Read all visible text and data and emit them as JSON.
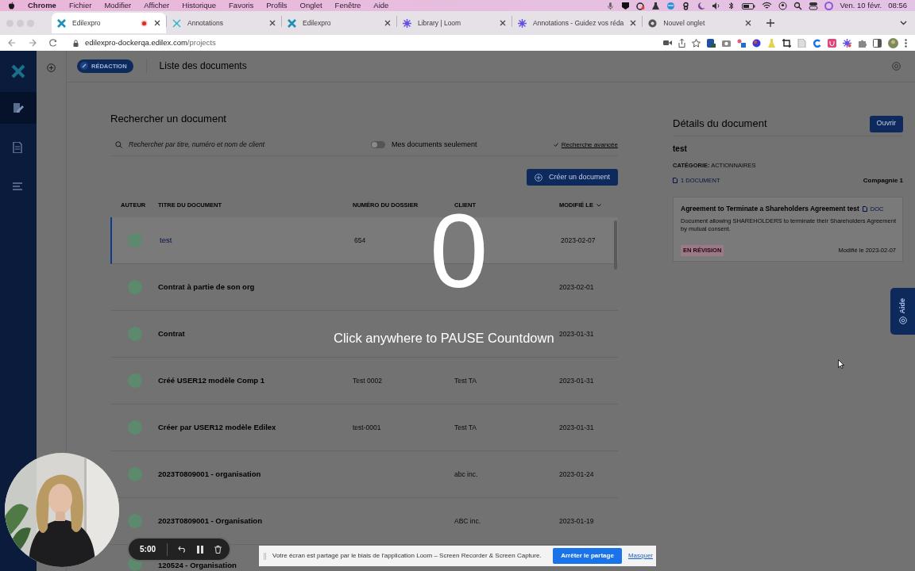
{
  "menubar": {
    "app_name": "Chrome",
    "menus": [
      "Fichier",
      "Modifier",
      "Afficher",
      "Historique",
      "Favoris",
      "Profils",
      "Onglet",
      "Fenêtre",
      "Aide"
    ],
    "date": "Ven. 10 févr.",
    "time": "08:56"
  },
  "tabs": [
    {
      "title": "Edilexpro",
      "kind": "edilex",
      "selected": true,
      "recording": true
    },
    {
      "title": "Annotations",
      "kind": "annotations",
      "selected": false,
      "recording": false
    },
    {
      "title": "Edilexpro",
      "kind": "edilex",
      "selected": false,
      "recording": false
    },
    {
      "title": "Library | Loom",
      "kind": "loom",
      "selected": false,
      "recording": false
    },
    {
      "title": "Annotations - Guidez vos réda",
      "kind": "loom",
      "selected": false,
      "recording": false
    },
    {
      "title": "Nouvel onglet",
      "kind": "chrome",
      "selected": false,
      "recording": false
    }
  ],
  "address": {
    "host": "edilexpro-dockerqa.edilex.com",
    "path": "/projects"
  },
  "app": {
    "mode_badge": "RÉDACTION",
    "page_title": "Liste des documents",
    "nav": [
      {
        "kind": "edit",
        "selected": true
      },
      {
        "kind": "document",
        "selected": false
      },
      {
        "kind": "list",
        "selected": false
      }
    ]
  },
  "search": {
    "heading": "Rechercher un document",
    "placeholder": "Rechercher par titre, numéro et nom de client",
    "toggle": {
      "label": "Mes documents seulement",
      "on": false
    },
    "advanced_link": "Recherche avancée",
    "create_button": "Créer un document"
  },
  "table": {
    "columns": [
      "AUTEUR",
      "TITRE DU DOCUMENT",
      "NUMÉRO DU DOSSIER",
      "CLIENT",
      "MODIFIÉ LE"
    ],
    "rows": [
      {
        "title": "test",
        "file_no": "654",
        "date": "2023-02-07",
        "selected": true
      },
      {
        "title": "Contrat à partie de son org",
        "date": "2023-02-01",
        "selected": false
      },
      {
        "title": "Contrat",
        "date": "2023-01-31",
        "selected": false
      },
      {
        "title": "Créé USER12 modèle Comp 1",
        "file_no": "Test 0002",
        "client": "Test TA",
        "date": "2023-01-31",
        "selected": false
      },
      {
        "title": "Créer par USER12 modèle Edilex",
        "file_no": "test-0001",
        "client": "Test TA",
        "date": "2023-01-31",
        "selected": false
      },
      {
        "title": "2023T0809001 - organisation",
        "client": "abc inc.",
        "date": "2023-01-24",
        "selected": false
      },
      {
        "title": "2023T0809001 - Organisation",
        "client": "ABC inc.",
        "date": "2023-01-19",
        "selected": false
      },
      {
        "title": "120524 - Organisation",
        "selected": false
      }
    ]
  },
  "details": {
    "heading": "Détails du document",
    "open_button": "Ouvrir",
    "name": "test",
    "category_label": "CATÉGORIE:",
    "category": "ACTIONNAIRES",
    "doc_count": "1 DOCUMENT",
    "company": "Compagnie 1",
    "document": {
      "title": "Agreement to Terminate a Shareholders Agreement test",
      "type": "DOC",
      "description": "Document allowing SHAREHOLDERS to terminate their Shareholders Agreement by mutual consent.",
      "status": "EN RÉVISION",
      "modified": "Modifié le 2023-02-07"
    }
  },
  "help_tab": "Aide",
  "countdown": {
    "number": "0",
    "hint": "Click anywhere to PAUSE Countdown"
  },
  "recorder": {
    "time": "5:00"
  },
  "share_banner": {
    "message": "Votre écran est partagé par le biais de l'application Loom – Screen Recorder & Screen Capture.",
    "stop_button": "Arrêter le partage",
    "hide_link": "Masquer"
  }
}
